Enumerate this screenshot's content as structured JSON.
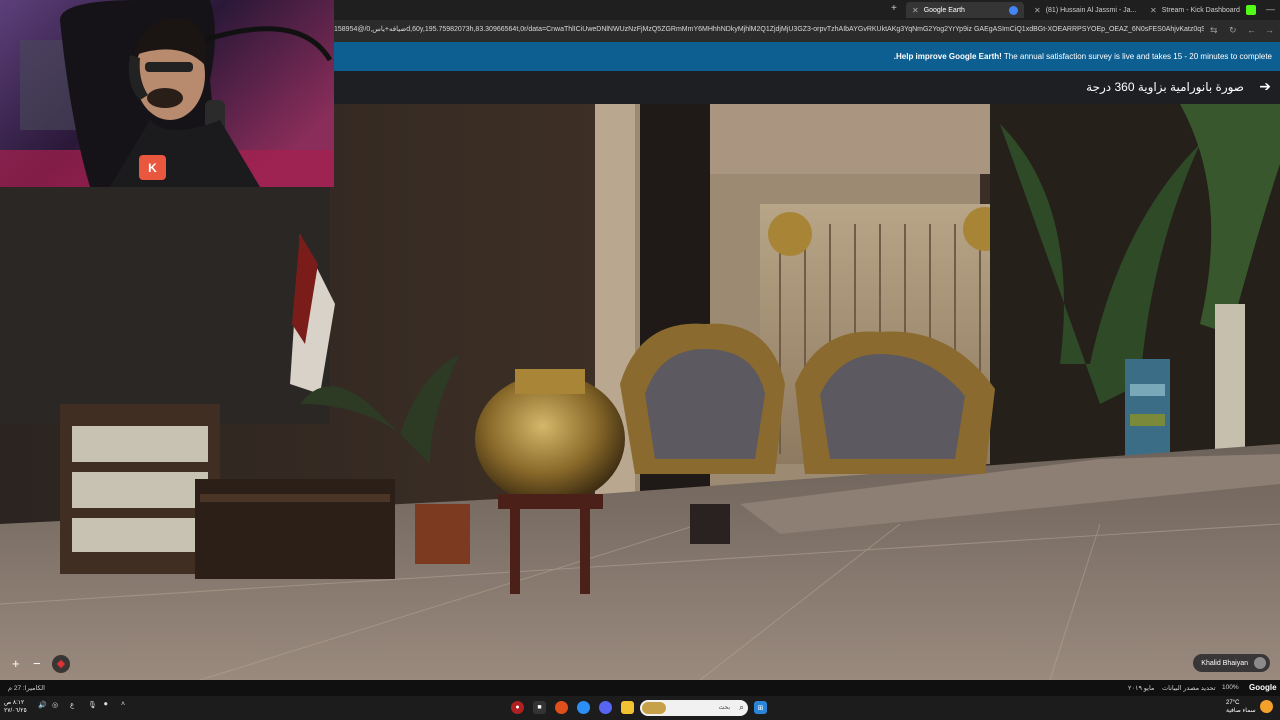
{
  "browser": {
    "tabs": [
      {
        "label": "Google Earth",
        "active": true,
        "favicon_color": "#4285f4"
      },
      {
        "label": "(81) Hussain Al Jassmi - Ja...",
        "active": false,
        "favicon_color": "#ff0000"
      },
      {
        "label": "Stream - Kick Dashboard",
        "active": false,
        "favicon_color": "#53fc18"
      }
    ],
    "new_tab": "+",
    "url": "158954@/ضيافه+ياس,0d,60y,195.75982073h,83.30966564t,0r/data=CnwaThlICiUweDNlNWUzNzFjMzQ5ZGRmMmY6MHhhNDkyMjhlM2Q1ZjdjMjU3GZ3-orpvTzhAIbAYGvRKUktAKg3YqNmG2Yog2YrYp9iz GAEgASImCiQ1xdBGt-XOEARRPSYOEp_OEAZ_6N0sFES0AhjvKatz0qS0BCAgg..."
  },
  "banner": {
    "strong": ".Help improve Google Earth!",
    "text": " The annual satisfaction survey is live and takes 15 - 20 minutes to complete"
  },
  "titlebar": {
    "title": "صورة بانورامية بزاوية 360 درجة",
    "back_icon": "arrow-right-icon"
  },
  "controls": {
    "zoom_in": "+",
    "zoom_out": "−"
  },
  "author": {
    "name": "Khalid Bhaiyan"
  },
  "attribution": {
    "cameras": "الكاميرا: 27 م",
    "date": "مايو ٢٠١٩",
    "update": "تحديد مصدر البيانات",
    "zoom": "100%",
    "logo": "Google"
  },
  "taskbar": {
    "search_placeholder": "بحث",
    "clock_time": "٨:١٢ ص",
    "clock_date": "٢٧/٠٦/٢٥",
    "lang": "ع",
    "weather_temp": "27°C",
    "weather_desc": "سماء صافية"
  },
  "webcam": {
    "badge": "K"
  },
  "colors": {
    "banner": "#0e5f91",
    "kick_green": "#53fc18",
    "kick_badge": "#e9573f"
  }
}
